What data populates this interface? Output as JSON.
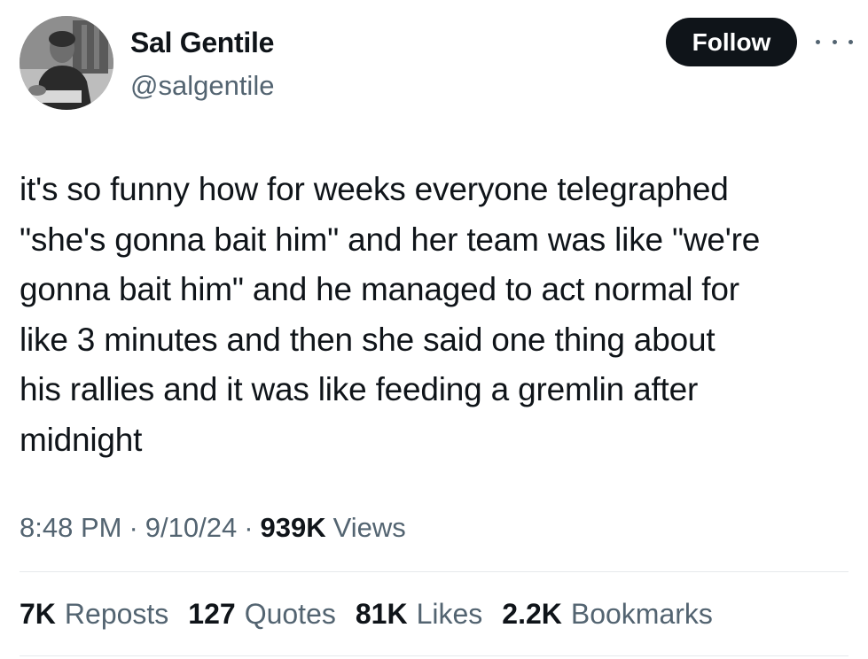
{
  "author": {
    "name": "Sal Gentile",
    "handle": "@salgentile"
  },
  "header": {
    "follow_label": "Follow",
    "more_icon": "more-horizontal-icon"
  },
  "tweet": {
    "text": "it's so funny how for weeks everyone telegraphed\n\"she's gonna bait him\" and her team was like \"we're\ngonna bait him\" and he managed to act normal for\nlike 3 minutes and then she said one thing about\nhis rallies and it was like feeding a gremlin after\nmidnight",
    "time": "8:48 PM",
    "separator": "·",
    "date": "9/10/24",
    "views_count": "939K",
    "views_label": "Views"
  },
  "stats": [
    {
      "count": "7K",
      "label": "Reposts"
    },
    {
      "count": "127",
      "label": "Quotes"
    },
    {
      "count": "81K",
      "label": "Likes"
    },
    {
      "count": "2.2K",
      "label": "Bookmarks"
    }
  ],
  "colors": {
    "text_primary": "#0f1419",
    "text_secondary": "#536471",
    "follow_bg": "#0f1419",
    "follow_text": "#ffffff",
    "divider": "#e6e9ec"
  }
}
